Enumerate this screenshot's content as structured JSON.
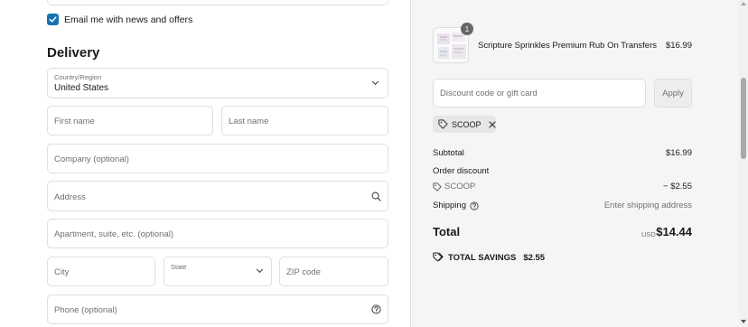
{
  "contact": {
    "email_news_checked": true,
    "email_news_label": "Email me with news and offers"
  },
  "delivery": {
    "title": "Delivery",
    "country": {
      "label": "Country/Region",
      "value": "United States"
    },
    "first_name": {
      "placeholder": "First name"
    },
    "last_name": {
      "placeholder": "Last name"
    },
    "company": {
      "placeholder": "Company (optional)"
    },
    "address": {
      "placeholder": "Address"
    },
    "apartment": {
      "placeholder": "Apartment, suite, etc. (optional)"
    },
    "city": {
      "placeholder": "City"
    },
    "state": {
      "label": "State"
    },
    "zip": {
      "placeholder": "ZIP code"
    },
    "phone": {
      "placeholder": "Phone (optional)"
    }
  },
  "summary": {
    "product": {
      "name": "Scripture Sprinkles Premium Rub On Transfers",
      "price": "$16.99",
      "quantity": "1"
    },
    "discount": {
      "placeholder": "Discount code or gift card",
      "apply_label": "Apply"
    },
    "applied_code": "SCOOP",
    "subtotal": {
      "label": "Subtotal",
      "value": "$16.99"
    },
    "order_discount": {
      "label": "Order discount",
      "code": "SCOOP",
      "value": "− $2.55"
    },
    "shipping": {
      "label": "Shipping",
      "value": "Enter shipping address"
    },
    "total": {
      "label": "Total",
      "currency": "USD",
      "value": "$14.44"
    },
    "savings": {
      "label": "TOTAL SAVINGS",
      "value": "$2.55"
    }
  },
  "colors": {
    "accent": "#1773b0",
    "summary_bg": "#f5f5f5",
    "border": "#dedede"
  }
}
